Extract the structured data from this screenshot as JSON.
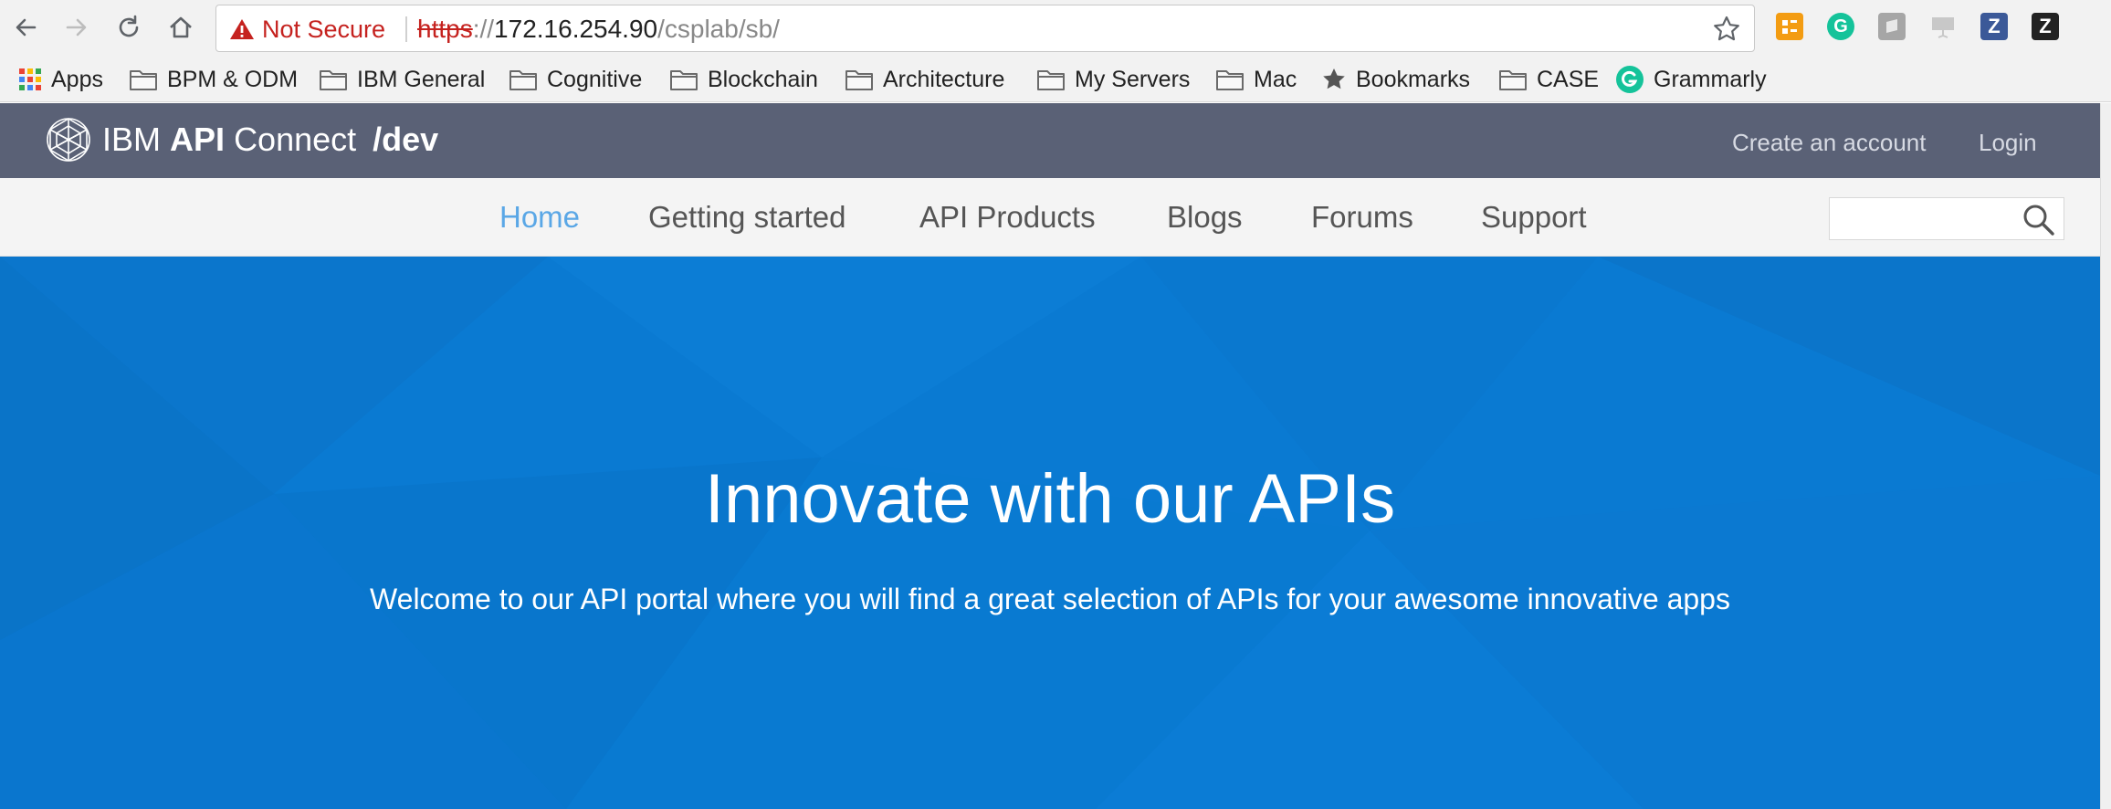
{
  "browser": {
    "security_label": "Not Secure",
    "url": {
      "scheme": "https",
      "separator": "://",
      "host": "172.16.254.90",
      "path": "/csplab/sb/"
    },
    "extensions": [
      "tasks-extension-icon",
      "grammarly-extension-icon",
      "shield-extension-icon",
      "presentation-extension-icon",
      "zotero-extension-icon",
      "z-extension-icon"
    ]
  },
  "bookmarks": [
    {
      "label": "Apps",
      "icon": "apps-grid-icon"
    },
    {
      "label": "BPM & ODM",
      "icon": "folder-icon"
    },
    {
      "label": "IBM General",
      "icon": "folder-icon"
    },
    {
      "label": "Cognitive",
      "icon": "folder-icon"
    },
    {
      "label": "Blockchain",
      "icon": "folder-icon"
    },
    {
      "label": "Architecture",
      "icon": "folder-icon"
    },
    {
      "label": "My Servers",
      "icon": "folder-icon"
    },
    {
      "label": "Mac",
      "icon": "folder-icon"
    },
    {
      "label": "Bookmarks",
      "icon": "star-icon"
    },
    {
      "label": "CASE",
      "icon": "folder-icon"
    },
    {
      "label": "Grammarly",
      "icon": "grammarly-icon"
    }
  ],
  "site": {
    "logo": {
      "ibm": "IBM",
      "api": "API",
      "connect": "Connect",
      "env": "/dev"
    },
    "account": {
      "create": "Create an account",
      "login": "Login"
    },
    "nav": [
      "Home",
      "Getting started",
      "API Products",
      "Blogs",
      "Forums",
      "Support"
    ],
    "active_nav": "Home",
    "search": {
      "value": "",
      "placeholder": ""
    }
  },
  "hero": {
    "title": "Innovate with our APIs",
    "subtitle": "Welcome to our API portal where you will find a great selection of APIs for your awesome innovative apps"
  },
  "colors": {
    "header_bg": "#5a6176",
    "hero_bg": "#0a7ad2",
    "active_nav": "#5aa7e6",
    "warning_red": "#c5221f"
  }
}
